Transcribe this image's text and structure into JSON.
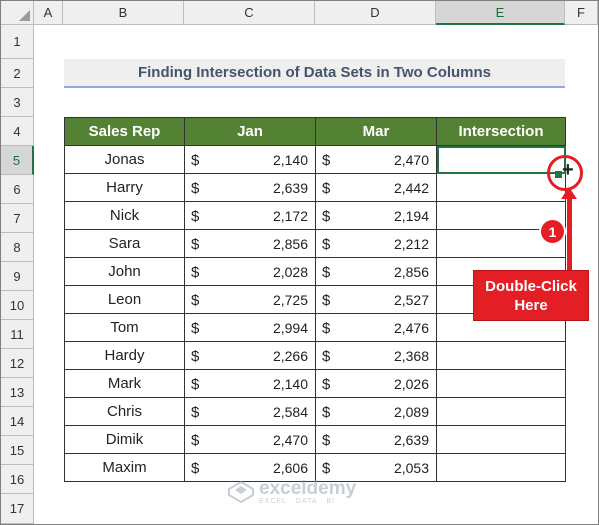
{
  "columns": [
    "A",
    "B",
    "C",
    "D",
    "E",
    "F"
  ],
  "rows": [
    "1",
    "2",
    "3",
    "4",
    "5",
    "6",
    "7",
    "8",
    "9",
    "10",
    "11",
    "12",
    "13",
    "14",
    "15",
    "16",
    "17"
  ],
  "title": "Finding Intersection of Data Sets in Two Columns",
  "table": {
    "headers": [
      "Sales Rep",
      "Jan",
      "Mar",
      "Intersection"
    ],
    "currency": "$",
    "rows": [
      {
        "name": "Jonas",
        "jan": "2,140",
        "mar": "2,470",
        "intersection": ""
      },
      {
        "name": "Harry",
        "jan": "2,639",
        "mar": "2,442",
        "intersection": ""
      },
      {
        "name": "Nick",
        "jan": "2,172",
        "mar": "2,194",
        "intersection": ""
      },
      {
        "name": "Sara",
        "jan": "2,856",
        "mar": "2,212",
        "intersection": ""
      },
      {
        "name": "John",
        "jan": "2,028",
        "mar": "2,856",
        "intersection": ""
      },
      {
        "name": "Leon",
        "jan": "2,725",
        "mar": "2,527",
        "intersection": ""
      },
      {
        "name": "Tom",
        "jan": "2,994",
        "mar": "2,476",
        "intersection": ""
      },
      {
        "name": "Hardy",
        "jan": "2,266",
        "mar": "2,368",
        "intersection": ""
      },
      {
        "name": "Mark",
        "jan": "2,140",
        "mar": "2,026",
        "intersection": ""
      },
      {
        "name": "Chris",
        "jan": "2,584",
        "mar": "2,089",
        "intersection": ""
      },
      {
        "name": "Dimik",
        "jan": "2,470",
        "mar": "2,639",
        "intersection": ""
      },
      {
        "name": "Maxim",
        "jan": "2,606",
        "mar": "2,053",
        "intersection": ""
      }
    ]
  },
  "annotation": {
    "step": "1",
    "callout_line1": "Double-Click",
    "callout_line2": "Here",
    "color": "#e31e24"
  },
  "selection": {
    "column": "E",
    "row": "5"
  },
  "watermark": {
    "name": "exceldemy",
    "tagline": "EXCEL · DATA · BI"
  },
  "colors": {
    "header_green": "#548235",
    "selection_green": "#217346",
    "title_text": "#44546a"
  }
}
